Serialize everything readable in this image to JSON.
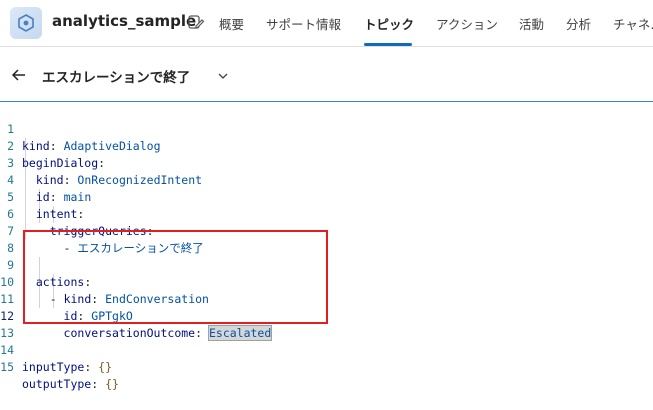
{
  "app": {
    "name": "analytics_sample"
  },
  "nav": {
    "tabs": [
      {
        "label": "概要"
      },
      {
        "label": "サポート情報"
      },
      {
        "label": "トピック"
      },
      {
        "label": "アクション"
      },
      {
        "label": "活動"
      },
      {
        "label": "分析"
      },
      {
        "label": "チャネ..."
      }
    ],
    "active_tab": "トピック"
  },
  "topic": {
    "title": "エスカレーションで終了"
  },
  "editor": {
    "current_line": 12,
    "lines": [
      {
        "n": "1",
        "key": "kind",
        "value": "AdaptiveDialog"
      },
      {
        "n": "2",
        "key": "beginDialog",
        "value": ""
      },
      {
        "n": "3",
        "key": "kind",
        "value": "OnRecognizedIntent"
      },
      {
        "n": "4",
        "key": "id",
        "value": "main"
      },
      {
        "n": "5",
        "key": "intent",
        "value": ""
      },
      {
        "n": "6",
        "key": "triggerQueries",
        "value": ""
      },
      {
        "n": "7",
        "key": "-",
        "value": "エスカレーションで終了"
      },
      {
        "n": "8",
        "key": "",
        "value": ""
      },
      {
        "n": "9",
        "key": "actions",
        "value": ""
      },
      {
        "n": "10",
        "key": "kind",
        "value": "EndConversation"
      },
      {
        "n": "11",
        "key": "id",
        "value": "GPTgkO"
      },
      {
        "n": "12",
        "key": "conversationOutcome",
        "value": "Escalated"
      },
      {
        "n": "13",
        "key": "",
        "value": ""
      },
      {
        "n": "14",
        "key": "inputType",
        "value": "{}"
      },
      {
        "n": "15",
        "key": "outputType",
        "value": "{}"
      }
    ]
  },
  "colors": {
    "accent": "#0f6cbd",
    "highlight_box": "#e02020",
    "yaml_key": "#001080",
    "yaml_value": "#0451a5",
    "line_number": "#237893"
  }
}
